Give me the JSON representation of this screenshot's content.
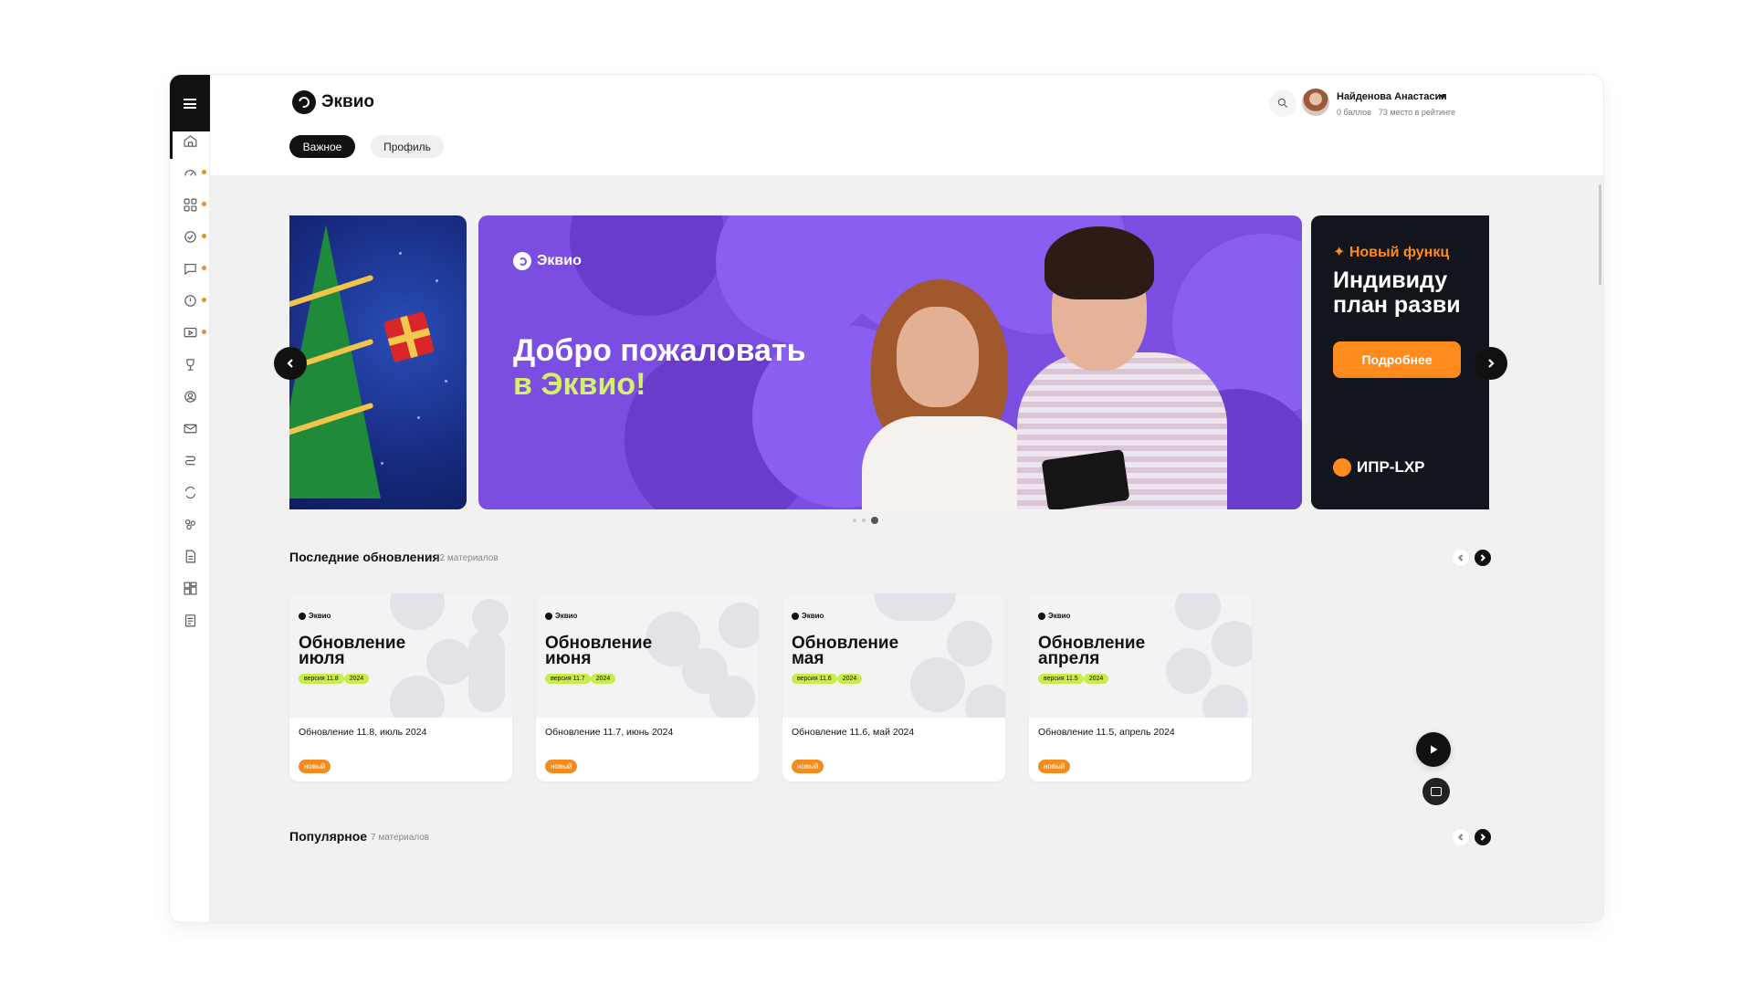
{
  "sidebar": {
    "menu_icon": "hamburger-icon",
    "items": [
      {
        "icon": "home-icon",
        "active": true,
        "dot": false
      },
      {
        "icon": "gauge-icon",
        "active": false,
        "dot": true
      },
      {
        "icon": "apps-icon",
        "active": false,
        "dot": true
      },
      {
        "icon": "check-circle-icon",
        "active": false,
        "dot": true
      },
      {
        "icon": "chat-icon",
        "active": false,
        "dot": true
      },
      {
        "icon": "info-icon",
        "active": false,
        "dot": true
      },
      {
        "icon": "video-icon",
        "active": false,
        "dot": true
      },
      {
        "icon": "trophy-icon",
        "active": false,
        "dot": false
      },
      {
        "icon": "user-circle-icon",
        "active": false,
        "dot": false
      },
      {
        "icon": "mail-icon",
        "active": false,
        "dot": false
      },
      {
        "icon": "route-icon",
        "active": false,
        "dot": false
      },
      {
        "icon": "sync-icon",
        "active": false,
        "dot": false
      },
      {
        "icon": "people-icon",
        "active": false,
        "dot": false
      },
      {
        "icon": "document-icon",
        "active": false,
        "dot": false
      },
      {
        "icon": "dashboard-icon",
        "active": false,
        "dot": false
      },
      {
        "icon": "checklist-icon",
        "active": false,
        "dot": false
      }
    ]
  },
  "header": {
    "logo_text": "Эквио",
    "tabs": [
      {
        "label": "Важное",
        "active": true
      },
      {
        "label": "Профиль",
        "active": false
      }
    ],
    "user": {
      "name": "Найденова Анастасия",
      "points": "0 баллов",
      "rank": "73 место в рейтинге"
    }
  },
  "banner": {
    "main": {
      "logo_text": "Эквио",
      "title_line1": "Добро пожаловать",
      "title_line2": "в Эквио!"
    },
    "side": {
      "tag": "✦ Новый функц",
      "title_line1": "Индивиду",
      "title_line2": "план разви",
      "button": "Подробнее",
      "footer": "ИПР-LXP"
    },
    "slides_count": 3,
    "active_slide": 3
  },
  "sections": {
    "updates": {
      "title": "Последние обновления",
      "count": "12 материалов",
      "cards": [
        {
          "logo": "Эквио",
          "headline": "Обновление\nиюля",
          "version": "версия 11.8",
          "year": "2024",
          "title": "Обновление 11.8, июль 2024",
          "badge": "новый"
        },
        {
          "logo": "Эквио",
          "headline": "Обновление\nиюня",
          "version": "версия 11.7",
          "year": "2024",
          "title": "Обновление 11.7, июнь 2024",
          "badge": "новый"
        },
        {
          "logo": "Эквио",
          "headline": "Обновление\nмая",
          "version": "версия 11.6",
          "year": "2024",
          "title": "Обновление 11.6, май 2024",
          "badge": "новый"
        },
        {
          "logo": "Эквио",
          "headline": "Обновление\nапреля",
          "version": "версия 11.5",
          "year": "2024",
          "title": "Обновление 11.5, апрель 2024",
          "badge": "новый"
        }
      ]
    },
    "popular": {
      "title": "Популярное",
      "count": "7 материалов"
    }
  },
  "colors": {
    "accent_dark": "#111111",
    "banner_purple": "#7b4de0",
    "banner_lime": "#d6f06b",
    "orange": "#f28c1e",
    "chip_lime": "#c8ec4a"
  }
}
